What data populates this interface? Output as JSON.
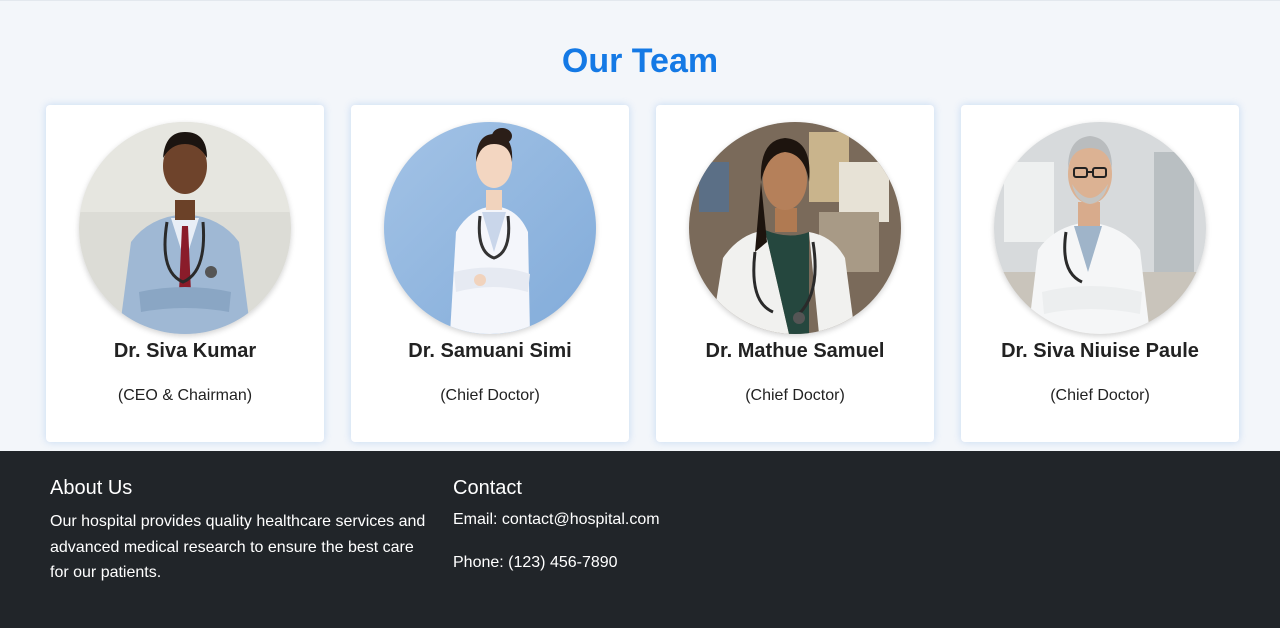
{
  "team": {
    "title": "Our Team",
    "members": [
      {
        "name": "Dr. Siva Kumar",
        "role": "(CEO & Chairman)"
      },
      {
        "name": "Dr. Samuani Simi",
        "role": "(Chief Doctor)"
      },
      {
        "name": "Dr. Mathue Samuel",
        "role": "(Chief Doctor)"
      },
      {
        "name": "Dr. Siva Niuise Paule",
        "role": "(Chief Doctor)"
      }
    ]
  },
  "footer": {
    "about": {
      "heading": "About Us",
      "text": "Our hospital provides quality healthcare services and advanced medical research to ensure the best care for our patients."
    },
    "contact": {
      "heading": "Contact",
      "email": "Email: contact@hospital.com",
      "phone": "Phone: (123) 456-7890"
    }
  },
  "colors": {
    "accent": "#1479e5",
    "footer_bg": "#212529",
    "page_bg": "#f3f6fa"
  }
}
